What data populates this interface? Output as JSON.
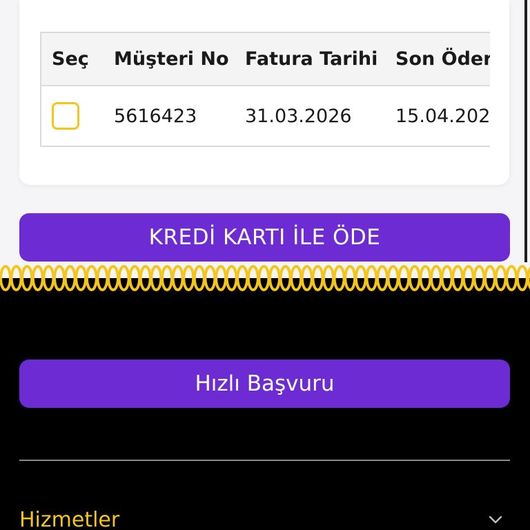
{
  "table": {
    "headers": [
      "Seç",
      "Müşteri No",
      "Fatura Tarihi",
      "Son Öder"
    ],
    "rows": [
      {
        "customer_no": "5616423",
        "invoice_date": "31.03.2026",
        "due_date": "15.04.202"
      }
    ]
  },
  "pay_button": {
    "label": "KREDİ KARTI İLE ÖDE"
  },
  "quick_apply": {
    "label": "Hızlı Başvuru"
  },
  "footer": {
    "services_label": "Hizmetler"
  },
  "icons": {
    "checkbox": "checkbox-empty-icon",
    "chevron": "chevron-down-icon"
  },
  "colors": {
    "primary": "#6c2bd3",
    "accent": "#f5c518",
    "dark_bg": "#000000",
    "light_bg": "#f5f5f7"
  }
}
